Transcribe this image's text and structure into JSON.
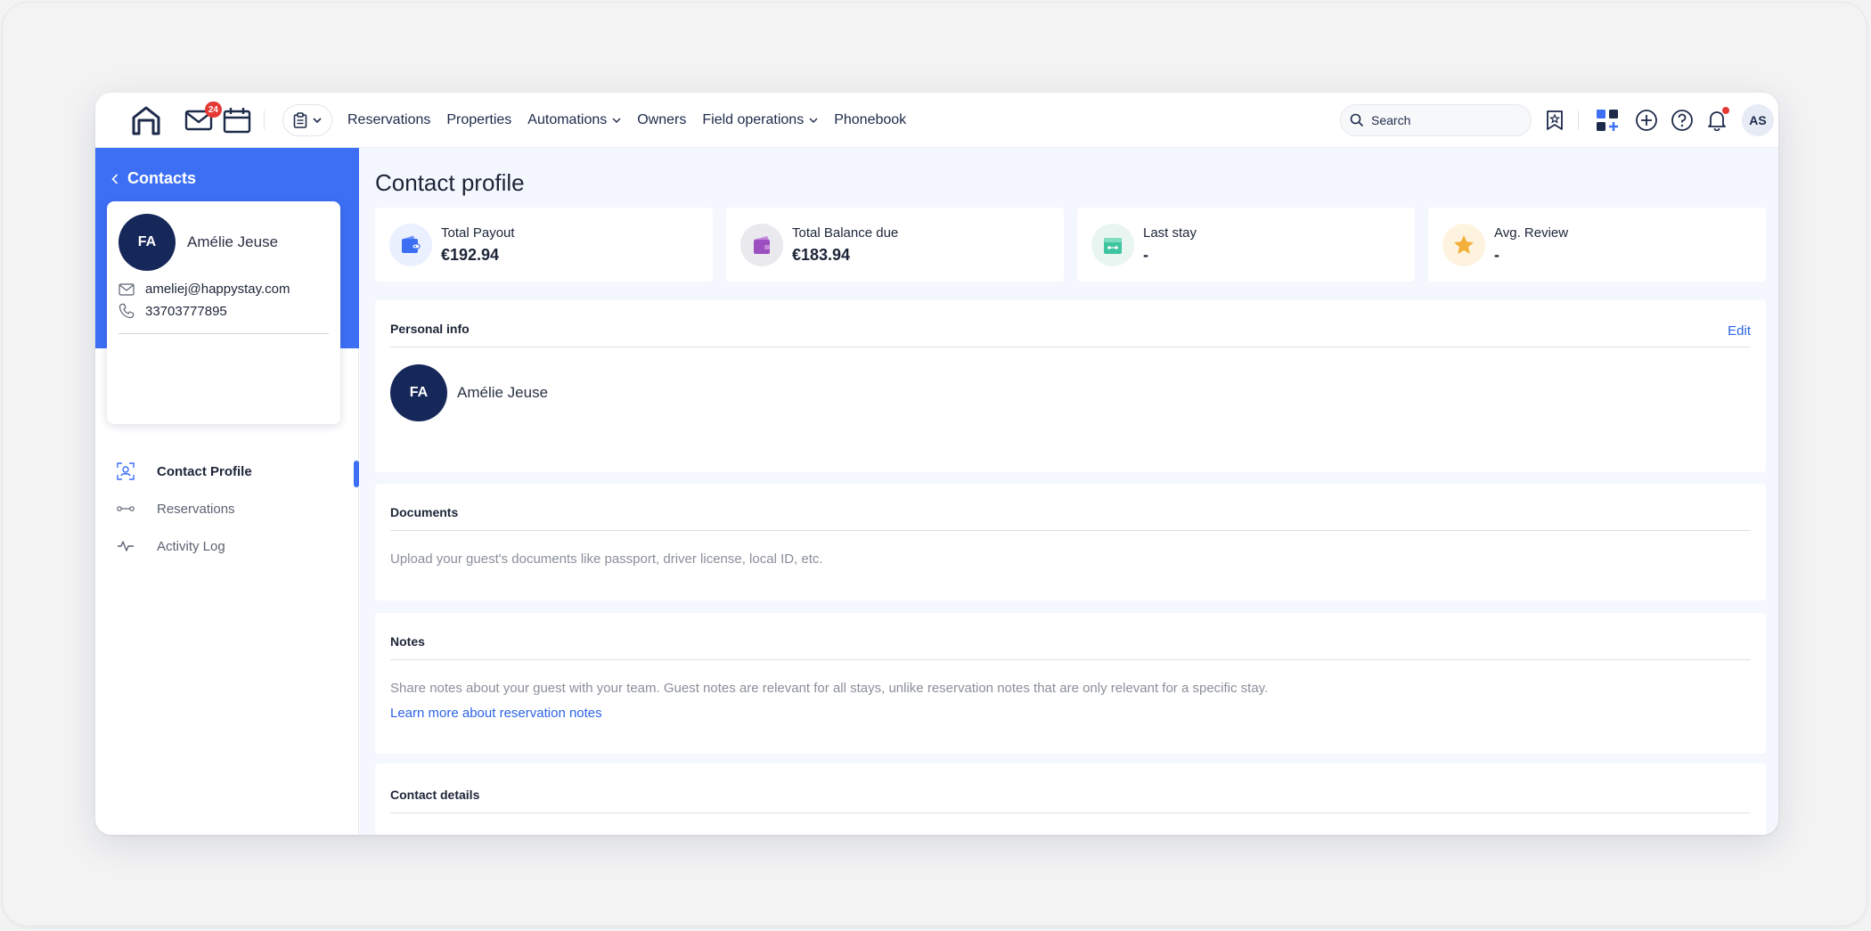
{
  "topbar": {
    "mail_badge": "24",
    "nav": [
      {
        "label": "Reservations"
      },
      {
        "label": "Properties"
      },
      {
        "label": "Automations"
      },
      {
        "label": "Owners"
      },
      {
        "label": "Field operations"
      },
      {
        "label": "Phonebook"
      }
    ],
    "search_placeholder": "Search",
    "user_initials": "AS"
  },
  "sidebar": {
    "back_label": "Contacts",
    "contact": {
      "initials": "FA",
      "name": "Amélie Jeuse",
      "email": "ameliej@happystay.com",
      "phone": "33703777895"
    },
    "menu": [
      {
        "label": "Contact Profile",
        "active": true
      },
      {
        "label": "Reservations",
        "active": false
      },
      {
        "label": "Activity Log",
        "active": false
      }
    ]
  },
  "main": {
    "title": "Contact profile",
    "stats": [
      {
        "label": "Total Payout",
        "value": "€192.94",
        "icon": "wallet-icon",
        "color": "#3d6ff5"
      },
      {
        "label": "Total Balance due",
        "value": "€183.94",
        "icon": "wallet-purple-icon",
        "color": "#9b4fc0"
      },
      {
        "label": "Last stay",
        "value": "-",
        "icon": "calendar-icon",
        "color": "#3fc4a0"
      },
      {
        "label": "Avg. Review",
        "value": "-",
        "icon": "star-icon",
        "color": "#f2b03a"
      }
    ],
    "personal_info": {
      "title": "Personal info",
      "edit_label": "Edit",
      "initials": "FA",
      "name": "Amélie Jeuse"
    },
    "documents": {
      "title": "Documents",
      "text": "Upload your guest's documents like passport, driver license, local ID, etc."
    },
    "notes": {
      "title": "Notes",
      "text": "Share notes about your guest with your team. Guest notes are relevant for all stays, unlike reservation notes that are only relevant for a specific stay.",
      "link": "Learn more about reservation notes"
    },
    "contact_details": {
      "title": "Contact details"
    }
  }
}
